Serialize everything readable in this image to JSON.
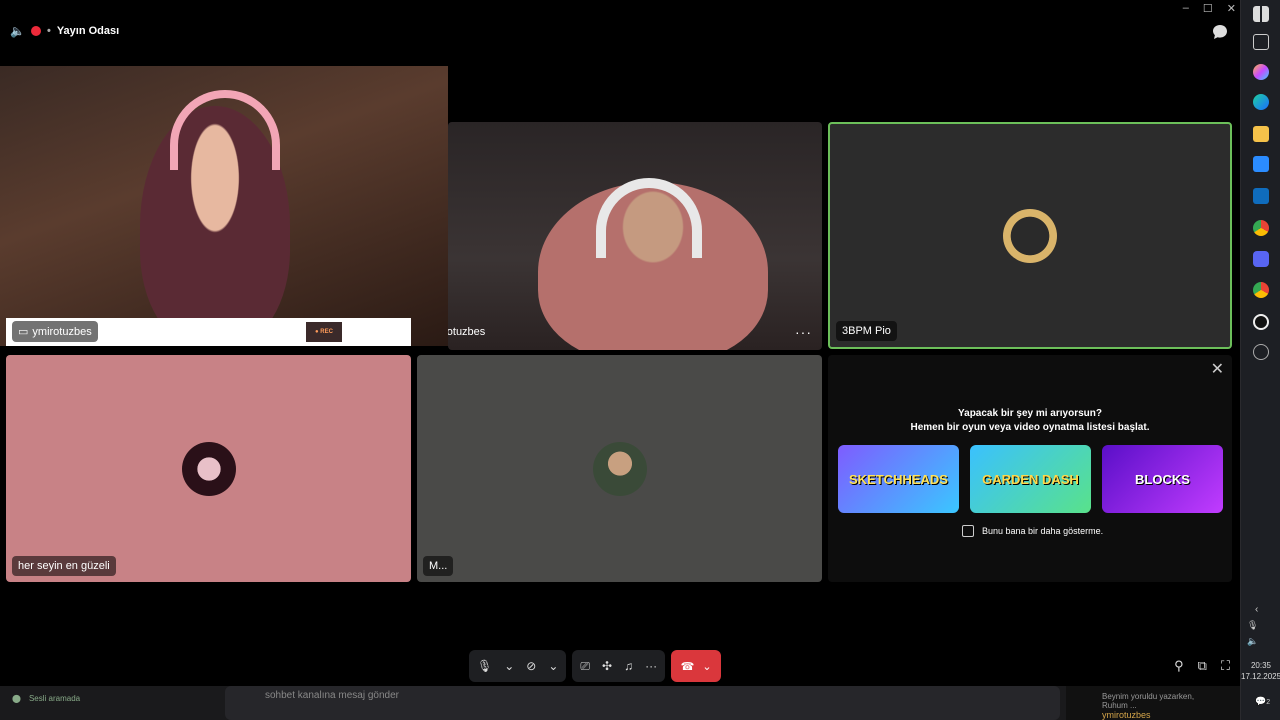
{
  "window": {
    "title": "Yayın Odası",
    "controls": [
      "–",
      "☐",
      "✕"
    ]
  },
  "tiles": {
    "cam1_name": "ymirotuzbes",
    "cam2_name": "ymirotuzbes",
    "tile3_name": "3BPM Pio",
    "tile4_name": "her seyin en güzeli",
    "tile5_name": "M...",
    "cam1_rec": "● REC",
    "more_label": "···"
  },
  "activity": {
    "line1": "Yapacak bir şey mi arıyorsun?",
    "line2": "Hemen bir oyun veya video oynatma listesi başlat.",
    "games": [
      "SKETCHHEADS",
      "GARDEN DASH",
      "BLOCKS"
    ],
    "dont_show": "Bunu bana bir daha gösterme.",
    "close": "✕"
  },
  "bottom": {
    "voice_status": "Sesli aramada",
    "message_placeholder": "sohbet kanalına mesaj gönder",
    "side_text": "Beynim yoruldu yazarken, Ruhum ...",
    "side_user": "ymirotuzbes"
  },
  "taskbar": {
    "time": "20:35",
    "date": "17.12.2025",
    "notif_count": "2"
  },
  "colors": {
    "speaking_border": "#6cbf5a",
    "hangup": "#da373c",
    "tile_pink": "#c88286",
    "tile_gray": "#4a4a48"
  }
}
